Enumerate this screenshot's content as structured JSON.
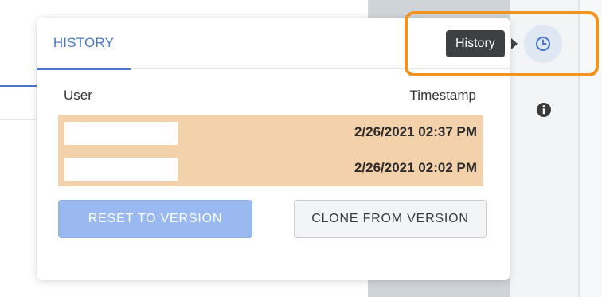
{
  "panel": {
    "tab_label": "HISTORY",
    "columns": {
      "user": "User",
      "timestamp": "Timestamp"
    },
    "rows": [
      {
        "user": "",
        "timestamp": "2/26/2021 02:37 PM"
      },
      {
        "user": "",
        "timestamp": "2/26/2021 02:02 PM"
      }
    ],
    "buttons": {
      "reset": "RESET TO VERSION",
      "clone": "CLONE FROM VERSION"
    }
  },
  "toolbar": {
    "tooltip": "History",
    "history_icon": "clock-icon",
    "info_icon": "info-icon"
  },
  "colors": {
    "accent": "#4a78c9",
    "row_highlight": "#f3d1ab",
    "callout": "#f39320"
  }
}
